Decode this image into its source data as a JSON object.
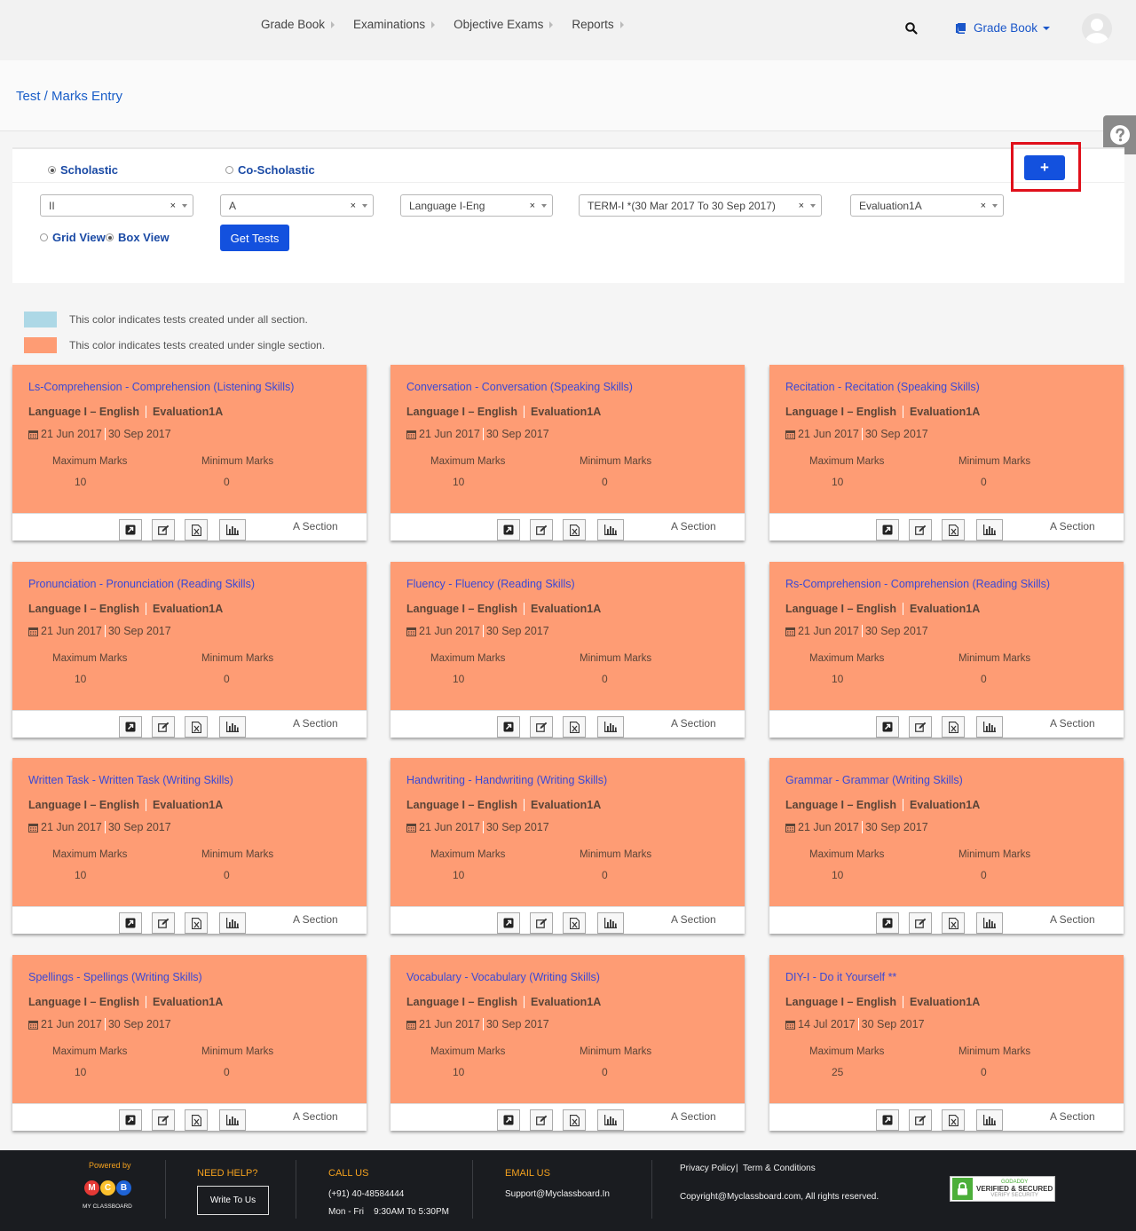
{
  "nav": {
    "items": [
      "Grade Book",
      "Examinations",
      "Objective Exams",
      "Reports"
    ],
    "grade_book_menu": "Grade Book"
  },
  "page_title": "Test / Marks Entry",
  "filters": {
    "scholastic": "Scholastic",
    "co_scholastic": "Co-Scholastic",
    "add_label": "+",
    "class": "II",
    "section": "A",
    "subject": "Language I-Eng",
    "term": "TERM-I *(30 Mar 2017 To 30 Sep 2017)",
    "evaluation": "Evaluation1A",
    "grid_view": "Grid View",
    "box_view": "Box View",
    "get_tests": "Get Tests",
    "clear_symbol": "×"
  },
  "legend": {
    "all_section": "This color indicates tests created under all section.",
    "single_section": "This color indicates tests created under single section.",
    "all_color": "#add8e6",
    "single_color": "#fe9c74"
  },
  "card_labels": {
    "max": "Maximum Marks",
    "min": "Minimum Marks"
  },
  "cards": [
    {
      "title": "Ls-Comprehension - Comprehension (Listening Skills)",
      "subject": "Language I – English",
      "evaluation": "Evaluation1A",
      "start": "21 Jun 2017",
      "end": "30 Sep 2017",
      "max": "10",
      "min": "0",
      "section": "A Section"
    },
    {
      "title": "Conversation - Conversation (Speaking Skills)",
      "subject": "Language I – English",
      "evaluation": "Evaluation1A",
      "start": "21 Jun 2017",
      "end": "30 Sep 2017",
      "max": "10",
      "min": "0",
      "section": "A Section"
    },
    {
      "title": "Recitation - Recitation (Speaking Skills)",
      "subject": "Language I – English",
      "evaluation": "Evaluation1A",
      "start": "21 Jun 2017",
      "end": "30 Sep 2017",
      "max": "10",
      "min": "0",
      "section": "A Section"
    },
    {
      "title": "Pronunciation - Pronunciation (Reading Skills)",
      "subject": "Language I – English",
      "evaluation": "Evaluation1A",
      "start": "21 Jun 2017",
      "end": "30 Sep 2017",
      "max": "10",
      "min": "0",
      "section": "A Section"
    },
    {
      "title": "Fluency - Fluency (Reading Skills)",
      "subject": "Language I – English",
      "evaluation": "Evaluation1A",
      "start": "21 Jun 2017",
      "end": "30 Sep 2017",
      "max": "10",
      "min": "0",
      "section": "A Section"
    },
    {
      "title": "Rs-Comprehension - Comprehension (Reading Skills)",
      "subject": "Language I – English",
      "evaluation": "Evaluation1A",
      "start": "21 Jun 2017",
      "end": "30 Sep 2017",
      "max": "10",
      "min": "0",
      "section": "A Section"
    },
    {
      "title": "Written Task - Written Task (Writing Skills)",
      "subject": "Language I – English",
      "evaluation": "Evaluation1A",
      "start": "21 Jun 2017",
      "end": "30 Sep 2017",
      "max": "10",
      "min": "0",
      "section": "A Section"
    },
    {
      "title": "Handwriting - Handwriting (Writing Skills)",
      "subject": "Language I – English",
      "evaluation": "Evaluation1A",
      "start": "21 Jun 2017",
      "end": "30 Sep 2017",
      "max": "10",
      "min": "0",
      "section": "A Section"
    },
    {
      "title": "Grammar - Grammar (Writing Skills)",
      "subject": "Language I – English",
      "evaluation": "Evaluation1A",
      "start": "21 Jun 2017",
      "end": "30 Sep 2017",
      "max": "10",
      "min": "0",
      "section": "A Section"
    },
    {
      "title": "Spellings - Spellings (Writing Skills)",
      "subject": "Language I – English",
      "evaluation": "Evaluation1A",
      "start": "21 Jun 2017",
      "end": "30 Sep 2017",
      "max": "10",
      "min": "0",
      "section": "A Section"
    },
    {
      "title": "Vocabulary - Vocabulary (Writing Skills)",
      "subject": "Language I – English",
      "evaluation": "Evaluation1A",
      "start": "21 Jun 2017",
      "end": "30 Sep 2017",
      "max": "10",
      "min": "0",
      "section": "A Section"
    },
    {
      "title": "DIY-I - Do it Yourself **",
      "subject": "Language I – English",
      "evaluation": "Evaluation1A",
      "start": "14 Jul 2017",
      "end": "30 Sep 2017",
      "max": "25",
      "min": "0",
      "section": "A Section"
    }
  ],
  "footer": {
    "powered_by": "Powered by",
    "logo_letters": [
      "M",
      "C",
      "B"
    ],
    "logo_text": "MY CLASSBOARD",
    "need_help": "NEED HELP?",
    "write_to_us": "Write To Us",
    "call_us": "CALL US",
    "phone": "(+91) 40-48584444",
    "hours": "Mon - Fri    9:30AM To 5:30PM",
    "email_us": "EMAIL US",
    "email": "Support@Myclassboard.In",
    "privacy": "Privacy Policy",
    "terms": "Term & Conditions",
    "link_sep": "|",
    "copyright": "Copyright@Myclassboard.com, All rights reserved.",
    "godaddy_brand": "GODADDY",
    "godaddy_verified": "VERIFIED & SECURED",
    "godaddy_verify": "VERIFY SECURITY"
  }
}
